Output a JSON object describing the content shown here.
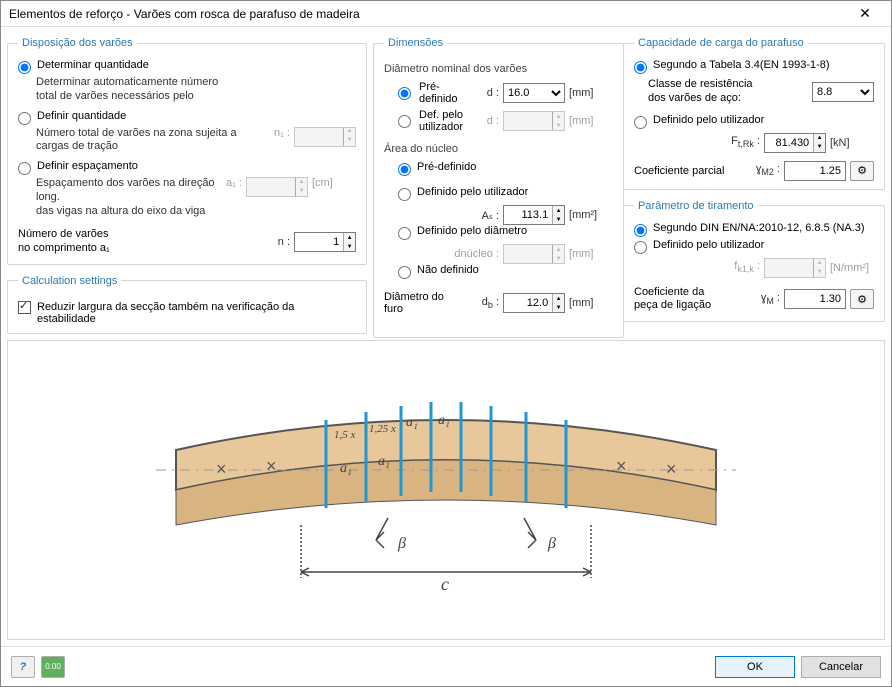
{
  "window": {
    "title": "Elementos de reforço - Varões com rosca de parafuso de madeira"
  },
  "col1": {
    "g1": {
      "legend": "Disposição dos varões",
      "opt1_label": "Determinar quantidade",
      "opt1_desc": "Determinar automaticamente número\ntotal de varões necessários pelo",
      "opt2_label": "Definir quantidade",
      "opt2_desc": "Número total de varões na zona sujeita a\ncargas de tração",
      "n1_sym": "n₁ :",
      "opt3_label": "Definir espaçamento",
      "opt3_desc": "Espaçamento dos varões na direção long.\ndas vigas na altura do eixo da viga",
      "a1_sym": "a₁ :",
      "a1_unit": "[cm]",
      "num_label_l1": "Número de varões",
      "num_label_l2": "no comprimento a₁",
      "n_sym": "n :",
      "n_value": "1"
    },
    "g2": {
      "legend": "Calculation settings",
      "chk_label": "Reduzir largura da secção também na verificação da estabilidade"
    }
  },
  "col2": {
    "legend": "Dimensões",
    "diam_head": "Diâmetro nominal dos varões",
    "predef": "Pré-definido",
    "d_sym": "d :",
    "d_value": "16.0",
    "mm": "[mm]",
    "userdef": "Def. pelo utilizador",
    "area_head": "Área do núcleo",
    "defuser": "Definido pelo utilizador",
    "as_sym": "Aₛ :",
    "as_value": "113.1",
    "mm2": "[mm²]",
    "defdiam": "Definido pelo diâmetro",
    "dnuc_sym": "dnúcleo :",
    "naodef": "Não definido",
    "furo_label": "Diâmetro do furo",
    "db_sym": "d_b :",
    "db_value": "12.0"
  },
  "col3": {
    "g1": {
      "legend": "Capacidade de carga do parafuso",
      "opt1_label": "Segundo a Tabela 3.4(EN 1993-1-8)",
      "classe_l1": "Classe de resistência",
      "classe_l2": "dos varões de aço:",
      "classe_value": "8.8",
      "opt2_label": "Definido pelo utilizador",
      "ftrk_sym": "Fₜ,Rk :",
      "ftrk_value": "81.430",
      "kn": "[kN]",
      "coef_label": "Coeficiente parcial",
      "gm2_sym": "ɣM2 :",
      "gm2_value": "1.25"
    },
    "g2": {
      "legend": "Parâmetro de tiramento",
      "opt1_label": "Segundo DIN EN/NA:2010-12, 6.8.5 (NA.3)",
      "opt2_label": "Definido pelo utilizador",
      "fk1k_sym": "fₖ₁,ₖ :",
      "nmm2": "[N/mm²]",
      "coef_l1": "Coeficiente da",
      "coef_l2": "peça de ligação",
      "gm_sym": "ɣM :",
      "gm_value": "1.30"
    }
  },
  "diagram": {
    "a1": "a₁",
    "x15": "1,5 x",
    "x125": "1,25 x",
    "beta": "β",
    "c": "c"
  },
  "buttons": {
    "ok": "OK",
    "cancel": "Cancelar"
  }
}
